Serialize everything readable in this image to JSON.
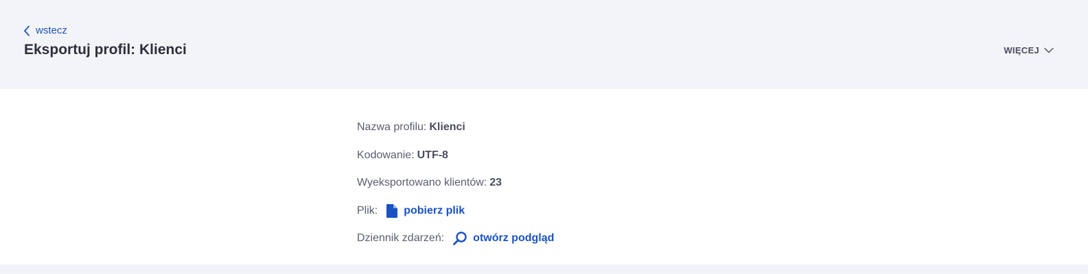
{
  "header": {
    "back_label": "wstecz",
    "title": "Eksportuj profil: Klienci",
    "more_label": "WIĘCEJ"
  },
  "details": {
    "profile_name_label": "Nazwa profilu:",
    "profile_name_value": "Klienci",
    "encoding_label": "Kodowanie:",
    "encoding_value": "UTF-8",
    "exported_label": "Wyeksportowano klientów:",
    "exported_value": "23",
    "file_label": "Plik:",
    "file_action": "pobierz plik",
    "log_label": "Dziennik zdarzeń:",
    "log_action": "otwórz podgląd"
  },
  "colors": {
    "accent": "#1a52c2",
    "header_bg": "#f3f4f8",
    "content_bg": "#ffffff",
    "text": "#2c2f3b"
  },
  "icons": {
    "back": "chevron-left-icon",
    "more": "chevron-down-icon",
    "file": "file-icon",
    "log": "search-icon"
  }
}
